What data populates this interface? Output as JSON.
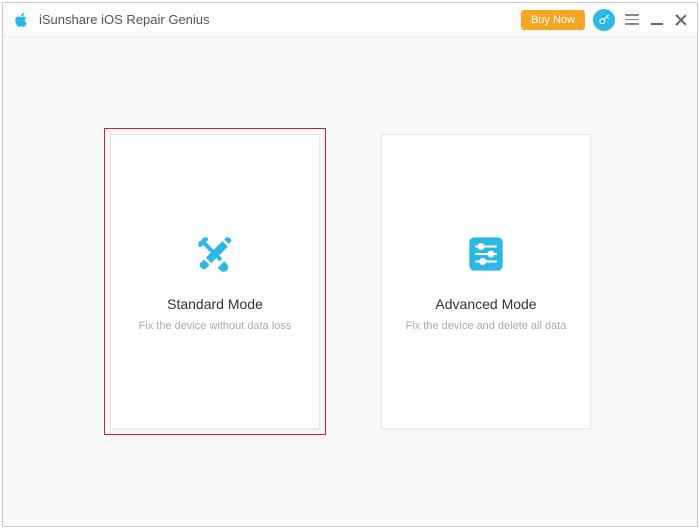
{
  "titlebar": {
    "app_name": "iSunshare iOS Repair Genius",
    "buy_label": "Buy Now"
  },
  "cards": {
    "standard": {
      "title": "Standard Mode",
      "desc": "Fix the device without data loss"
    },
    "advanced": {
      "title": "Advanced Mode",
      "desc": "Fix the device and delete all data"
    }
  },
  "colors": {
    "accent": "#2bb8e6",
    "buy": "#f5a623",
    "highlight": "#d42020"
  }
}
